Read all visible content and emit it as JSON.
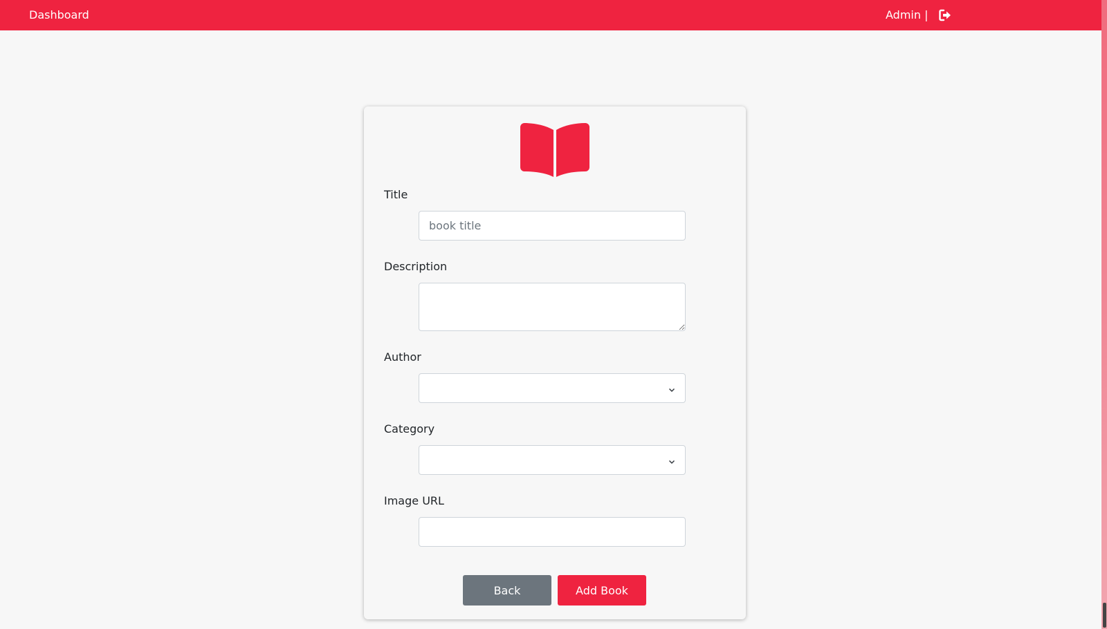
{
  "navbar": {
    "brand": "Dashboard",
    "user": "Admin |",
    "logout_icon": "sign-out-icon"
  },
  "form": {
    "header_icon": "open-book-icon",
    "title_label": "Title",
    "title_placeholder": "book title",
    "title_value": "",
    "description_label": "Description",
    "description_value": "",
    "author_label": "Author",
    "author_value": "",
    "category_label": "Category",
    "category_value": "",
    "image_url_label": "Image URL",
    "image_url_value": "",
    "back_label": "Back",
    "add_label": "Add Book"
  },
  "colors": {
    "accent": "#ef2340",
    "secondary": "#6c757d",
    "background": "#f7f7f7"
  }
}
